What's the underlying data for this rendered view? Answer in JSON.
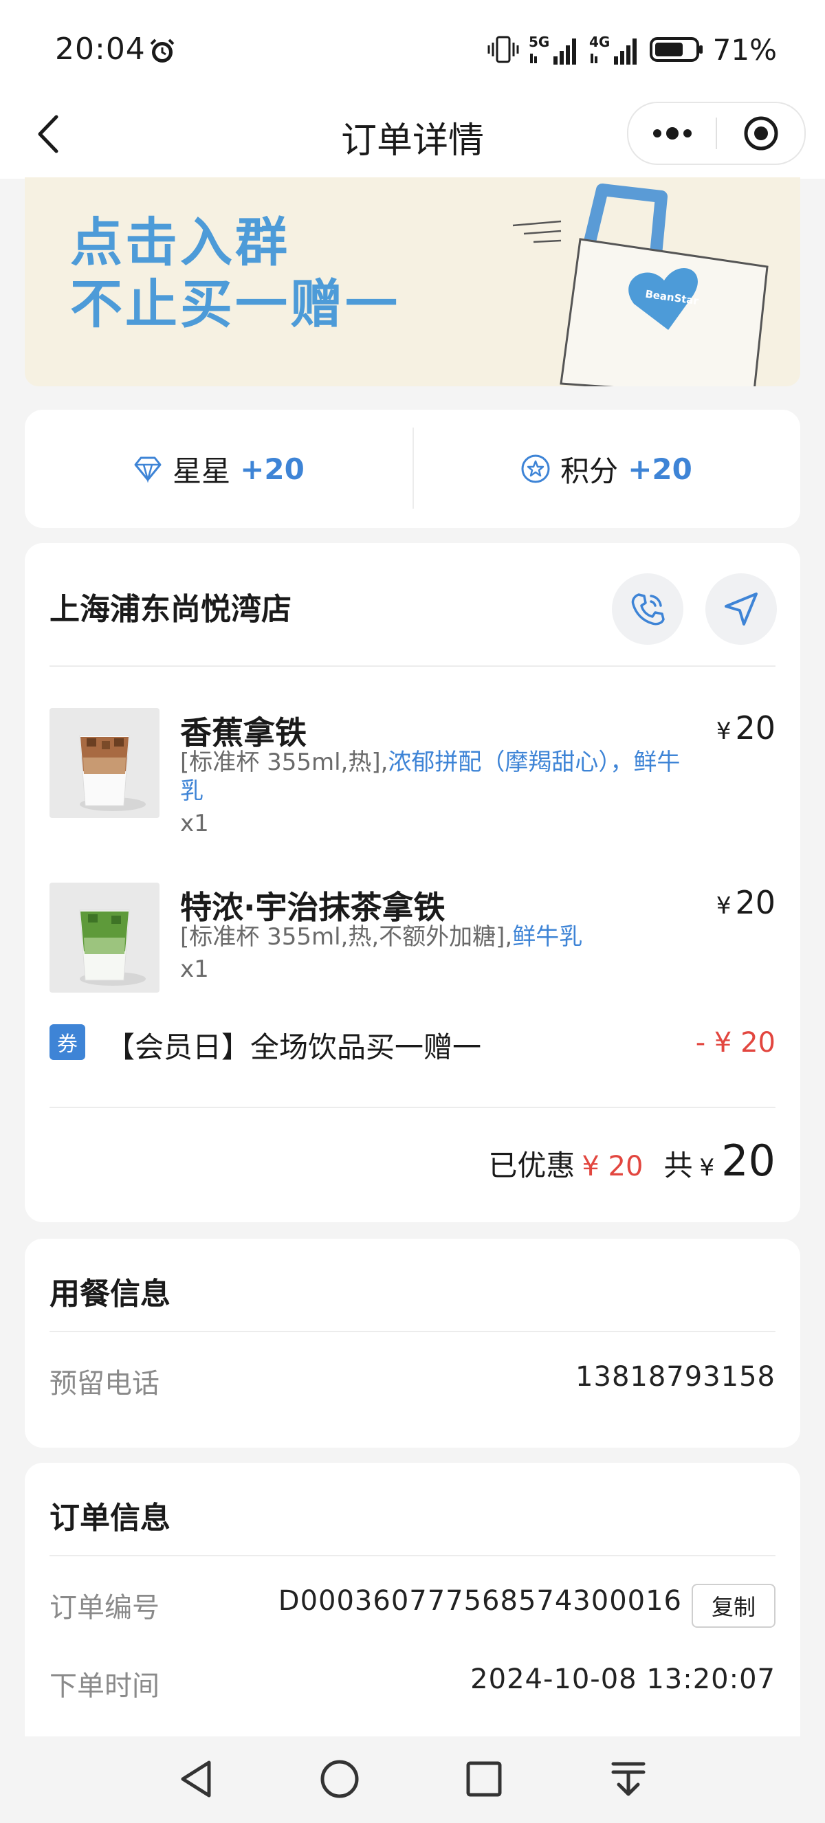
{
  "status_bar": {
    "time": "20:04",
    "network_5g": "5G",
    "network_4g": "4G",
    "battery": "71%",
    "battery_level": 0.71
  },
  "nav": {
    "title": "订单详情",
    "icons": [
      "back-icon",
      "more-icon",
      "target-icon"
    ]
  },
  "banner": {
    "line1": "点击入群",
    "line2": "不止买一赠一",
    "bag_brand": "BeanStar"
  },
  "rewards": {
    "stars_label": "星星",
    "stars_value": "+20",
    "points_label": "积分",
    "points_value": "+20"
  },
  "order": {
    "store_name": "上海浦东尚悦湾店",
    "items": [
      {
        "name": "香蕉拿铁",
        "currency": "¥",
        "price": "20",
        "spec_plain": "[标准杯 355ml,热],",
        "spec_highlight": "浓郁拼配（摩羯甜心），鲜牛乳",
        "qty": "x1"
      },
      {
        "name": "特浓·宇治抹茶拿铁",
        "currency": "¥",
        "price": "20",
        "spec_plain": "[标准杯 355ml,热,不额外加糖],",
        "spec_highlight": "鲜牛乳",
        "qty": "x1"
      }
    ],
    "coupon": {
      "tag": "券",
      "text": "【会员日】全场饮品买一赠一",
      "amount": "- ¥ 20"
    },
    "totals": {
      "discount_label": "已优惠",
      "discount_value": "¥ 20",
      "total_label": "共",
      "currency": "¥",
      "total_value": "20"
    }
  },
  "dining_info": {
    "title": "用餐信息",
    "phone_label": "预留电话",
    "phone_value": "13818793158"
  },
  "order_info": {
    "title": "订单信息",
    "number_label": "订单编号",
    "number_value": "D000360777568574300016",
    "copy_label": "复制",
    "time_label": "下单时间",
    "time_value": "2024-10-08 13:20:07"
  },
  "colors": {
    "accent": "#3e84d6",
    "discount_red": "#e2463f",
    "banner_bg": "#f6f1e2",
    "banner_text": "#4d9bd8"
  }
}
